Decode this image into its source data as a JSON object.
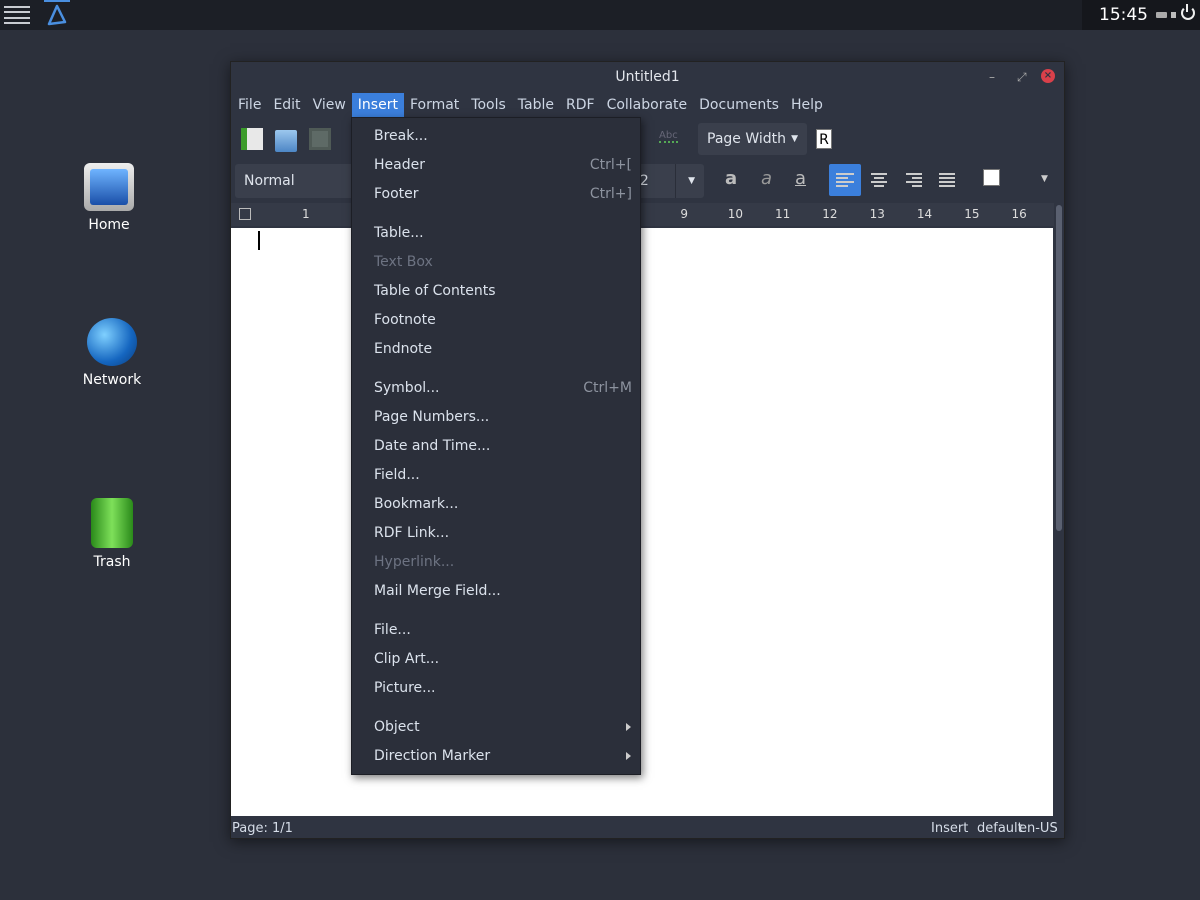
{
  "panel": {
    "clock": "15:45"
  },
  "desktop": {
    "icons": [
      {
        "label": "Home"
      },
      {
        "label": "Network"
      },
      {
        "label": "Trash"
      }
    ]
  },
  "window": {
    "title": "Untitled1",
    "menubar": [
      "File",
      "Edit",
      "View",
      "Insert",
      "Format",
      "Tools",
      "Table",
      "RDF",
      "Collaborate",
      "Documents",
      "Help"
    ],
    "active_menu": "Insert",
    "toolbar": {
      "zoom": "Page Width",
      "style": "Normal",
      "font_size": "12"
    },
    "ruler": [
      "1",
      "9",
      "10",
      "11",
      "12",
      "13",
      "14",
      "15",
      "16"
    ],
    "status": {
      "page": "Page: 1/1",
      "mode": "Insert",
      "lang_default": "default",
      "lang": "en-US"
    }
  },
  "insert_menu": [
    {
      "label": "Break..."
    },
    {
      "label": "Header",
      "shortcut": "Ctrl+["
    },
    {
      "label": "Footer",
      "shortcut": "Ctrl+]"
    },
    {
      "label": "Table..."
    },
    {
      "label": "Text Box",
      "disabled": true
    },
    {
      "label": "Table of Contents"
    },
    {
      "label": "Footnote"
    },
    {
      "label": "Endnote"
    },
    {
      "label": "Symbol...",
      "shortcut": "Ctrl+M"
    },
    {
      "label": "Page Numbers..."
    },
    {
      "label": "Date and Time..."
    },
    {
      "label": "Field..."
    },
    {
      "label": "Bookmark..."
    },
    {
      "label": "RDF Link..."
    },
    {
      "label": "Hyperlink...",
      "disabled": true
    },
    {
      "label": "Mail Merge Field..."
    },
    {
      "label": "File..."
    },
    {
      "label": "Clip Art..."
    },
    {
      "label": "Picture..."
    },
    {
      "label": "Object",
      "submenu": true
    },
    {
      "label": "Direction Marker",
      "submenu": true
    }
  ],
  "colors": {
    "accent": "#3b7fdc",
    "desktop": "#2c303b",
    "close": "#d9404a"
  }
}
